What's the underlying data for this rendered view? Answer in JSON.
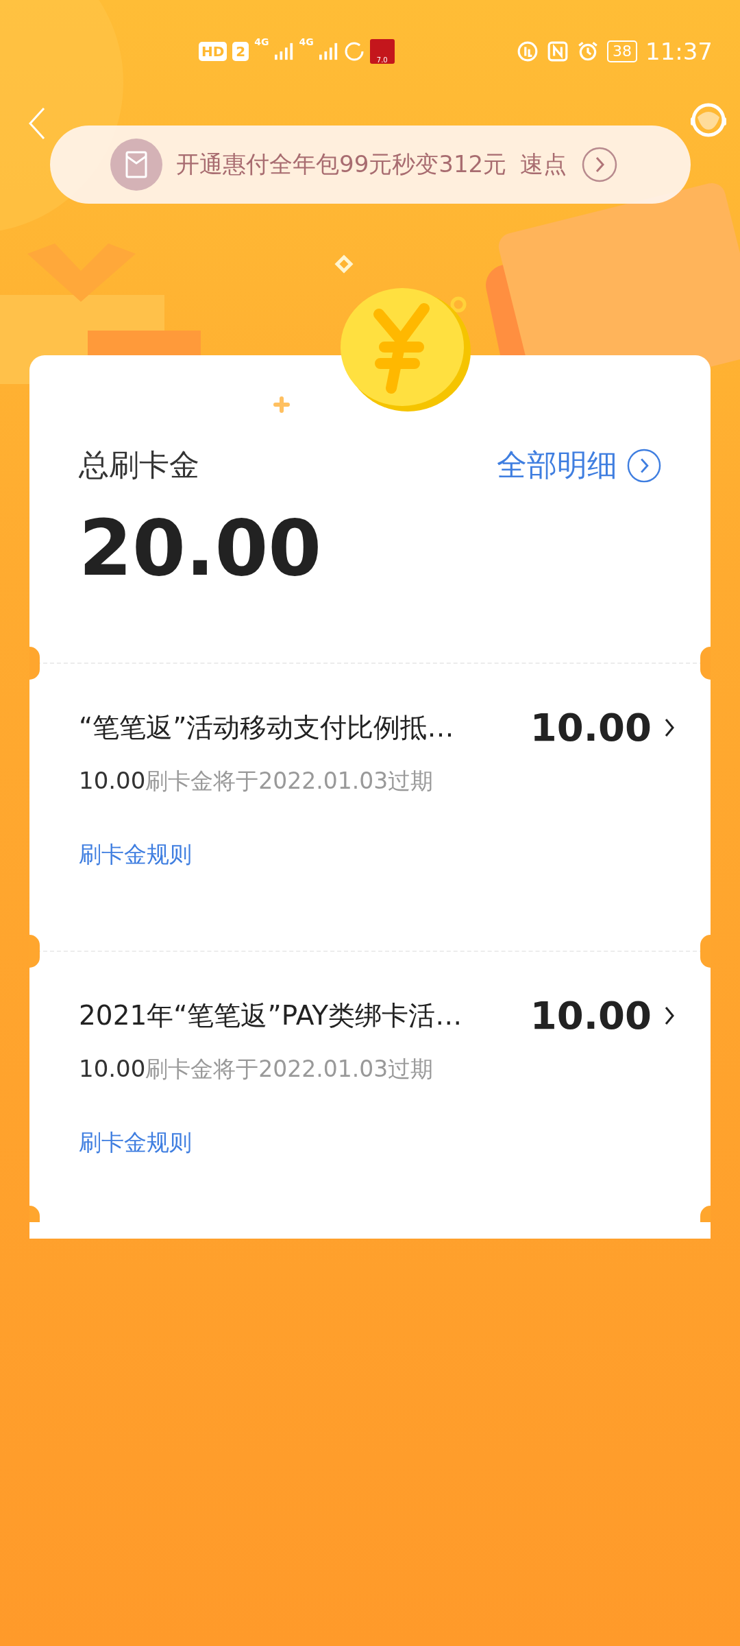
{
  "status_bar": {
    "hd": "HD",
    "sim": "2",
    "net_1": "4G",
    "net_2": "4G",
    "app_badge": "7.0",
    "battery": "38",
    "time": "11:37"
  },
  "banner": {
    "text": "开通惠付全年包99元秒变312元",
    "action": "速点"
  },
  "summary": {
    "label": "总刷卡金",
    "link": "全部明细",
    "amount": "20.00"
  },
  "items": [
    {
      "title": "“笔笔返”活动移动支付比例抵…",
      "amount": "10.00",
      "sub_amount": "10.00",
      "expiry": "刷卡金将于2022.01.03过期",
      "rules": "刷卡金规则"
    },
    {
      "title": "2021年“笔笔返”PAY类绑卡活…",
      "amount": "10.00",
      "sub_amount": "10.00",
      "expiry": "刷卡金将于2022.01.03过期",
      "rules": "刷卡金规则"
    }
  ]
}
